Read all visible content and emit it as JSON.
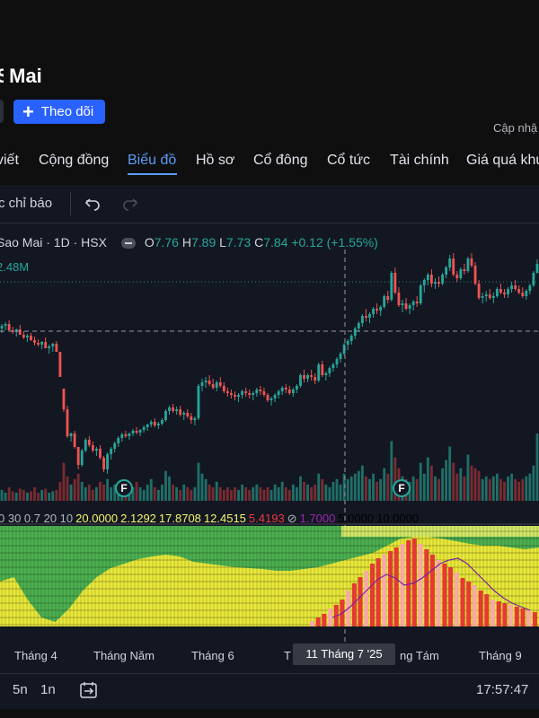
{
  "header": {
    "stock_name": "Mai",
    "follow_label": "Theo dõi",
    "updated_label": "Cập nhậ"
  },
  "tabs": [
    "viết",
    "Cộng đồng",
    "Biểu đồ",
    "Hồ sơ",
    "Cổ đông",
    "Cổ tức",
    "Tài chính",
    "Giá quá khứ"
  ],
  "active_tab": "Biểu đồ",
  "toolbar": {
    "indicators_label": "c chỉ báo"
  },
  "legend": {
    "symbol": "Sao Mai · 1D · HSX",
    "open_key": "O",
    "open": "7.76",
    "high_key": "H",
    "high": "7.89",
    "low_key": "L",
    "low": "7.73",
    "close_key": "C",
    "close": "7.84",
    "change": "+0.12 (+1.55%)",
    "volume": "2.48M"
  },
  "indicator_values": [
    {
      "text": "0 30 0.7 20 10",
      "color": "#b2b5be"
    },
    {
      "text": "20.0000",
      "color": "#f5f56b"
    },
    {
      "text": "2.1292",
      "color": "#f5f56b"
    },
    {
      "text": "17.8708",
      "color": "#f5f56b"
    },
    {
      "text": "12.4515",
      "color": "#f5f56b"
    },
    {
      "text": "5.4193",
      "color": "#f23645"
    },
    {
      "text": "⊘",
      "color": "#b2b5be"
    },
    {
      "text": "1.7000",
      "color": "#9c27b0"
    },
    {
      "text": "5.0000",
      "color": "#000000"
    },
    {
      "text": "10.0000",
      "color": "#000000"
    }
  ],
  "time_axis": {
    "months": [
      "Tháng 4",
      "Tháng Năm",
      "Tháng 6",
      "T",
      "ng Tám",
      "Tháng 9"
    ],
    "cursor_label": "11 Tháng 7 '25"
  },
  "bottom_bar": {
    "ranges": [
      "5n",
      "1n"
    ],
    "clock": "17:57:47",
    "goto_icon": "calendar-goto-icon"
  },
  "markers": [
    "F",
    "F"
  ],
  "colors": {
    "up": "#26a69a",
    "down": "#ef5350",
    "accent": "#2962ff",
    "active_tab": "#5b9cf6",
    "panel_bg": "#131722"
  },
  "chart_data": {
    "type": "candlestick",
    "symbol": "Sao Mai · 1D · HSX",
    "y_range": [
      5.4,
      8.0
    ],
    "candles": [
      [
        7.12,
        7.17,
        7.07,
        7.15
      ],
      [
        7.15,
        7.19,
        7.1,
        7.17
      ],
      [
        7.17,
        7.21,
        7.12,
        7.1
      ],
      [
        7.1,
        7.14,
        7.06,
        7.08
      ],
      [
        7.08,
        7.12,
        7.03,
        7.11
      ],
      [
        7.11,
        7.16,
        7.08,
        7.05
      ],
      [
        7.05,
        7.09,
        7.0,
        7.02
      ],
      [
        7.02,
        7.06,
        6.97,
        7.04
      ],
      [
        7.04,
        7.07,
        6.98,
        6.99
      ],
      [
        6.99,
        7.03,
        6.93,
        6.96
      ],
      [
        6.96,
        7.0,
        6.92,
        6.94
      ],
      [
        6.94,
        6.98,
        6.89,
        6.97
      ],
      [
        6.97,
        7.02,
        6.93,
        6.9
      ],
      [
        6.9,
        6.94,
        6.84,
        6.92
      ],
      [
        6.92,
        6.96,
        6.86,
        6.95
      ],
      [
        6.95,
        6.98,
        6.89,
        6.86
      ],
      [
        6.86,
        6.86,
        6.58,
        6.58
      ],
      [
        6.45,
        6.45,
        6.19,
        6.22
      ],
      [
        6.22,
        6.26,
        5.9,
        5.92
      ],
      [
        5.92,
        5.96,
        5.86,
        5.95
      ],
      [
        5.95,
        5.98,
        5.78,
        5.8
      ],
      [
        5.8,
        5.8,
        5.55,
        5.6
      ],
      [
        5.6,
        5.78,
        5.58,
        5.76
      ],
      [
        5.76,
        5.9,
        5.74,
        5.88
      ],
      [
        5.88,
        5.92,
        5.8,
        5.82
      ],
      [
        5.82,
        5.86,
        5.74,
        5.76
      ],
      [
        5.76,
        5.8,
        5.7,
        5.78
      ],
      [
        5.78,
        5.82,
        5.66,
        5.68
      ],
      [
        5.68,
        5.7,
        5.52,
        5.55
      ],
      [
        5.55,
        5.74,
        5.5,
        5.72
      ],
      [
        5.72,
        5.8,
        5.66,
        5.78
      ],
      [
        5.78,
        5.86,
        5.74,
        5.84
      ],
      [
        5.84,
        5.92,
        5.8,
        5.9
      ],
      [
        5.9,
        5.96,
        5.86,
        5.94
      ],
      [
        5.94,
        5.98,
        5.9,
        5.92
      ],
      [
        5.92,
        5.96,
        5.88,
        5.95
      ],
      [
        5.95,
        6.0,
        5.92,
        5.98
      ],
      [
        5.98,
        6.02,
        5.94,
        5.96
      ],
      [
        5.96,
        6.0,
        5.92,
        5.99
      ],
      [
        5.99,
        6.04,
        5.96,
        6.02
      ],
      [
        6.02,
        6.06,
        5.98,
        6.05
      ],
      [
        6.05,
        6.1,
        6.02,
        6.08
      ],
      [
        6.08,
        6.12,
        6.02,
        6.04
      ],
      [
        6.04,
        6.08,
        6.0,
        6.06
      ],
      [
        6.06,
        6.12,
        6.04,
        6.1
      ],
      [
        6.1,
        6.22,
        6.08,
        6.2
      ],
      [
        6.2,
        6.26,
        6.16,
        6.24
      ],
      [
        6.24,
        6.28,
        6.18,
        6.2
      ],
      [
        6.2,
        6.25,
        6.16,
        6.22
      ],
      [
        6.22,
        6.26,
        6.14,
        6.16
      ],
      [
        6.16,
        6.2,
        6.1,
        6.18
      ],
      [
        6.18,
        6.22,
        6.12,
        6.14
      ],
      [
        6.14,
        6.18,
        6.06,
        6.1
      ],
      [
        6.1,
        6.14,
        6.04,
        6.12
      ],
      [
        6.12,
        6.5,
        6.1,
        6.48
      ],
      [
        6.48,
        6.56,
        6.42,
        6.52
      ],
      [
        6.52,
        6.58,
        6.46,
        6.54
      ],
      [
        6.54,
        6.6,
        6.48,
        6.5
      ],
      [
        6.5,
        6.56,
        6.44,
        6.46
      ],
      [
        6.46,
        6.54,
        6.42,
        6.52
      ],
      [
        6.52,
        6.58,
        6.46,
        6.48
      ],
      [
        6.48,
        6.52,
        6.4,
        6.42
      ],
      [
        6.42,
        6.46,
        6.36,
        6.4
      ],
      [
        6.4,
        6.44,
        6.34,
        6.38
      ],
      [
        6.38,
        6.42,
        6.32,
        6.36
      ],
      [
        6.36,
        6.4,
        6.3,
        6.38
      ],
      [
        6.38,
        6.44,
        6.34,
        6.42
      ],
      [
        6.42,
        6.46,
        6.36,
        6.4
      ],
      [
        6.4,
        6.44,
        6.34,
        6.38
      ],
      [
        6.38,
        6.42,
        6.32,
        6.4
      ],
      [
        6.4,
        6.46,
        6.36,
        6.44
      ],
      [
        6.44,
        6.48,
        6.38,
        6.42
      ],
      [
        6.42,
        6.46,
        6.36,
        6.38
      ],
      [
        6.38,
        6.4,
        6.3,
        6.32
      ],
      [
        6.32,
        6.36,
        6.26,
        6.34
      ],
      [
        6.34,
        6.4,
        6.3,
        6.38
      ],
      [
        6.38,
        6.44,
        6.34,
        6.42
      ],
      [
        6.42,
        6.48,
        6.38,
        6.46
      ],
      [
        6.46,
        6.5,
        6.4,
        6.44
      ],
      [
        6.44,
        6.48,
        6.38,
        6.4
      ],
      [
        6.4,
        6.46,
        6.36,
        6.44
      ],
      [
        6.44,
        6.5,
        6.4,
        6.48
      ],
      [
        6.48,
        6.62,
        6.46,
        6.6
      ],
      [
        6.6,
        6.66,
        6.52,
        6.56
      ],
      [
        6.56,
        6.62,
        6.52,
        6.6
      ],
      [
        6.6,
        6.66,
        6.54,
        6.58
      ],
      [
        6.58,
        6.62,
        6.5,
        6.54
      ],
      [
        6.54,
        6.74,
        6.52,
        6.72
      ],
      [
        6.72,
        6.76,
        6.58,
        6.6
      ],
      [
        6.6,
        6.64,
        6.54,
        6.62
      ],
      [
        6.62,
        6.7,
        6.58,
        6.68
      ],
      [
        6.68,
        6.74,
        6.64,
        6.72
      ],
      [
        6.72,
        6.8,
        6.68,
        6.78
      ],
      [
        6.78,
        6.86,
        6.74,
        6.84
      ],
      [
        6.84,
        6.96,
        6.82,
        6.94
      ],
      [
        6.94,
        7.0,
        6.88,
        6.98
      ],
      [
        6.98,
        7.06,
        6.94,
        7.04
      ],
      [
        7.04,
        7.14,
        7.0,
        7.12
      ],
      [
        7.12,
        7.2,
        7.08,
        7.18
      ],
      [
        7.18,
        7.28,
        7.14,
        7.26
      ],
      [
        7.26,
        7.34,
        7.2,
        7.24
      ],
      [
        7.24,
        7.3,
        7.18,
        7.28
      ],
      [
        7.28,
        7.36,
        7.24,
        7.34
      ],
      [
        7.34,
        7.4,
        7.28,
        7.32
      ],
      [
        7.32,
        7.38,
        7.26,
        7.36
      ],
      [
        7.36,
        7.5,
        7.34,
        7.48
      ],
      [
        7.48,
        7.54,
        7.4,
        7.44
      ],
      [
        7.44,
        7.76,
        7.42,
        7.74
      ],
      [
        7.74,
        7.8,
        7.5,
        7.52
      ],
      [
        7.52,
        7.58,
        7.36,
        7.38
      ],
      [
        7.38,
        7.44,
        7.3,
        7.4
      ],
      [
        7.4,
        7.46,
        7.32,
        7.34
      ],
      [
        7.34,
        7.4,
        7.28,
        7.38
      ],
      [
        7.38,
        7.44,
        7.32,
        7.42
      ],
      [
        7.42,
        7.48,
        7.36,
        7.4
      ],
      [
        7.4,
        7.62,
        7.38,
        7.6
      ],
      [
        7.6,
        7.68,
        7.52,
        7.66
      ],
      [
        7.66,
        7.74,
        7.6,
        7.72
      ],
      [
        7.72,
        7.78,
        7.58,
        7.62
      ],
      [
        7.62,
        7.68,
        7.56,
        7.64
      ],
      [
        7.64,
        7.7,
        7.58,
        7.62
      ],
      [
        7.62,
        7.74,
        7.6,
        7.72
      ],
      [
        7.72,
        7.82,
        7.68,
        7.8
      ],
      [
        7.8,
        7.94,
        7.76,
        7.9
      ],
      [
        7.9,
        7.96,
        7.7,
        7.72
      ],
      [
        7.72,
        7.76,
        7.64,
        7.68
      ],
      [
        7.68,
        7.8,
        7.66,
        7.78
      ],
      [
        7.78,
        7.84,
        7.72,
        7.76
      ],
      [
        7.76,
        7.92,
        7.74,
        7.9
      ],
      [
        7.9,
        7.96,
        7.8,
        7.82
      ],
      [
        7.82,
        7.86,
        7.6,
        7.62
      ],
      [
        7.62,
        7.66,
        7.44,
        7.46
      ],
      [
        7.46,
        7.52,
        7.4,
        7.48
      ],
      [
        7.48,
        7.54,
        7.42,
        7.5
      ],
      [
        7.5,
        7.56,
        7.44,
        7.46
      ],
      [
        7.46,
        7.52,
        7.4,
        7.48
      ],
      [
        7.48,
        7.58,
        7.46,
        7.56
      ],
      [
        7.56,
        7.62,
        7.5,
        7.52
      ],
      [
        7.52,
        7.56,
        7.46,
        7.5
      ],
      [
        7.5,
        7.58,
        7.46,
        7.56
      ],
      [
        7.56,
        7.64,
        7.52,
        7.6
      ],
      [
        7.6,
        7.66,
        7.54,
        7.56
      ],
      [
        7.56,
        7.6,
        7.5,
        7.52
      ],
      [
        7.52,
        7.58,
        7.46,
        7.48
      ],
      [
        7.48,
        7.56,
        7.44,
        7.54
      ],
      [
        7.54,
        7.62,
        7.5,
        7.6
      ],
      [
        7.6,
        7.76,
        7.58,
        7.74
      ],
      [
        7.74,
        7.89,
        7.73,
        7.84
      ]
    ],
    "volume_max": 2.48,
    "volume": [
      0.4,
      0.3,
      0.5,
      0.35,
      0.3,
      0.45,
      0.4,
      0.3,
      0.35,
      0.5,
      0.3,
      0.4,
      0.45,
      0.3,
      0.35,
      0.4,
      0.7,
      1.4,
      0.9,
      0.6,
      0.8,
      1.0,
      0.7,
      0.5,
      0.6,
      0.4,
      0.5,
      0.7,
      0.6,
      0.8,
      0.5,
      0.6,
      0.4,
      0.5,
      0.6,
      0.4,
      0.5,
      0.7,
      0.5,
      0.4,
      0.6,
      0.8,
      0.5,
      0.4,
      0.6,
      1.1,
      0.9,
      0.6,
      0.5,
      0.4,
      0.6,
      0.5,
      0.4,
      0.5,
      1.4,
      1.0,
      0.8,
      0.6,
      0.5,
      0.7,
      0.5,
      0.4,
      0.5,
      0.4,
      0.5,
      0.4,
      0.6,
      0.5,
      0.4,
      0.5,
      0.6,
      0.5,
      0.4,
      0.5,
      0.4,
      0.6,
      0.5,
      0.7,
      0.5,
      0.4,
      0.6,
      0.5,
      0.9,
      0.7,
      0.6,
      0.5,
      0.6,
      1.0,
      0.8,
      0.6,
      0.5,
      0.7,
      0.8,
      0.6,
      1.0,
      0.8,
      0.9,
      1.0,
      1.1,
      1.3,
      0.9,
      0.8,
      1.0,
      0.7,
      0.8,
      1.2,
      1.0,
      2.2,
      1.6,
      1.2,
      0.9,
      0.8,
      0.7,
      0.9,
      0.8,
      1.4,
      1.0,
      1.6,
      1.3,
      0.9,
      0.8,
      1.2,
      1.5,
      2.0,
      1.4,
      1.0,
      1.2,
      0.9,
      1.7,
      1.3,
      1.2,
      1.1,
      0.8,
      0.9,
      0.8,
      0.9,
      1.0,
      0.8,
      0.7,
      0.9,
      1.0,
      0.8,
      0.7,
      0.8,
      0.9,
      1.0,
      1.3,
      2.48
    ],
    "crosshair_price": 7.09,
    "volume_reference_price": 7.64
  }
}
